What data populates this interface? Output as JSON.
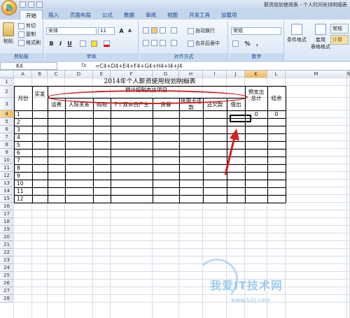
{
  "window": {
    "title": "薪资规划使用表 - 个人时间安排明细表"
  },
  "ribbon": {
    "tabs": [
      "开始",
      "插入",
      "页面布局",
      "公式",
      "数据",
      "审阅",
      "视图",
      "开发工具",
      "加载项"
    ],
    "clipboard": {
      "cut": "剪切",
      "copy": "复制",
      "paste": "粘贴",
      "format_painter": "格式刷",
      "label": "剪贴板"
    },
    "font": {
      "name": "宋体",
      "size": "11",
      "label": "字体",
      "bold": "B",
      "italic": "I",
      "underline": "U",
      "grow": "A",
      "shrink": "A"
    },
    "alignment": {
      "wrap": "自动换行",
      "merge": "合并后居中",
      "label": "对齐方式"
    },
    "number": {
      "format": "常规",
      "percent": "%",
      "comma": ",",
      "label": "数字"
    },
    "styles": {
      "conditional": "条件格式",
      "table_format": "套用\n表格格式",
      "normal": "常规",
      "calc": "计算"
    }
  },
  "formula_bar": {
    "name_box": "K4",
    "fx": "fx",
    "formula": "=C4+D4+E4+F4+G4+H4+I4+J4"
  },
  "sheet": {
    "columns": [
      "A",
      "B",
      "C",
      "D",
      "E",
      "F",
      "G",
      "H",
      "I",
      "J",
      "K",
      "L",
      "M",
      "N"
    ],
    "rows": [
      "1",
      "2",
      "3",
      "4",
      "5",
      "6",
      "7",
      "8",
      "9",
      "10",
      "11",
      "12",
      "13",
      "14",
      "15",
      "16",
      "17",
      "18",
      "19",
      "20",
      "21",
      "22",
      "23",
      "24",
      "25",
      "26",
      "27",
      "28"
    ],
    "title": "2014年个人薪资使用规划明细表",
    "header_group": "预计控制支出项目",
    "month_label": "月份",
    "actual_label": "实发",
    "balance_label": "结余",
    "expense_cols": [
      "话费",
      "人际关系",
      "购物",
      "7个双休日产生",
      "房餐",
      "信用卡还款",
      "还欠款",
      "借出"
    ],
    "total_label": "预支出总计",
    "months": [
      "1",
      "2",
      "3",
      "4",
      "5",
      "6",
      "7",
      "8",
      "9",
      "10",
      "11",
      "12"
    ],
    "k4_value": "0",
    "l4_value": "0"
  },
  "watermark": {
    "text": "我爱IT技术网",
    "url": "www.52ij.com"
  }
}
